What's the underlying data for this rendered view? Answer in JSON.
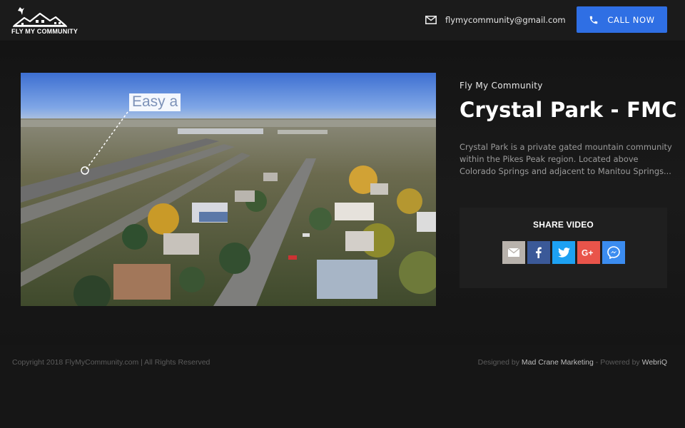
{
  "header": {
    "logo_text": "FLY MY COMMUNITY",
    "email": "flymycommunity@gmail.com",
    "email_icon": "mail-icon",
    "call_label": "CALL NOW",
    "call_icon": "phone-icon",
    "accent_color": "#2f6fe4"
  },
  "video": {
    "overlay_text": "Easy a",
    "content": "aerial drone footage of a suburban neighborhood"
  },
  "info": {
    "subtitle": "Fly My Community",
    "title": "Crystal Park - FMC",
    "description": "Crystal Park is a private gated mountain community within the Pikes Peak region. Located above Colorado Springs and adjacent to Manitou Springs..."
  },
  "share": {
    "title": "SHARE VIDEO",
    "buttons": [
      {
        "icon": "email-icon",
        "color": "#b8b2ac"
      },
      {
        "icon": "facebook-icon",
        "color": "#3b5998"
      },
      {
        "icon": "twitter-icon",
        "color": "#1da1f2"
      },
      {
        "icon": "google-plus-icon",
        "color": "#e9544a"
      },
      {
        "icon": "messenger-icon",
        "color": "#3b8cf0"
      }
    ]
  },
  "footer": {
    "copyright": "Copyright 2018 FlyMyCommunity.com | All Rights Reserved",
    "designed_prefix": "Designed by",
    "designer": "Mad Crane Marketing",
    "powered_prefix": "- Powered by",
    "powered": "WebriQ"
  }
}
